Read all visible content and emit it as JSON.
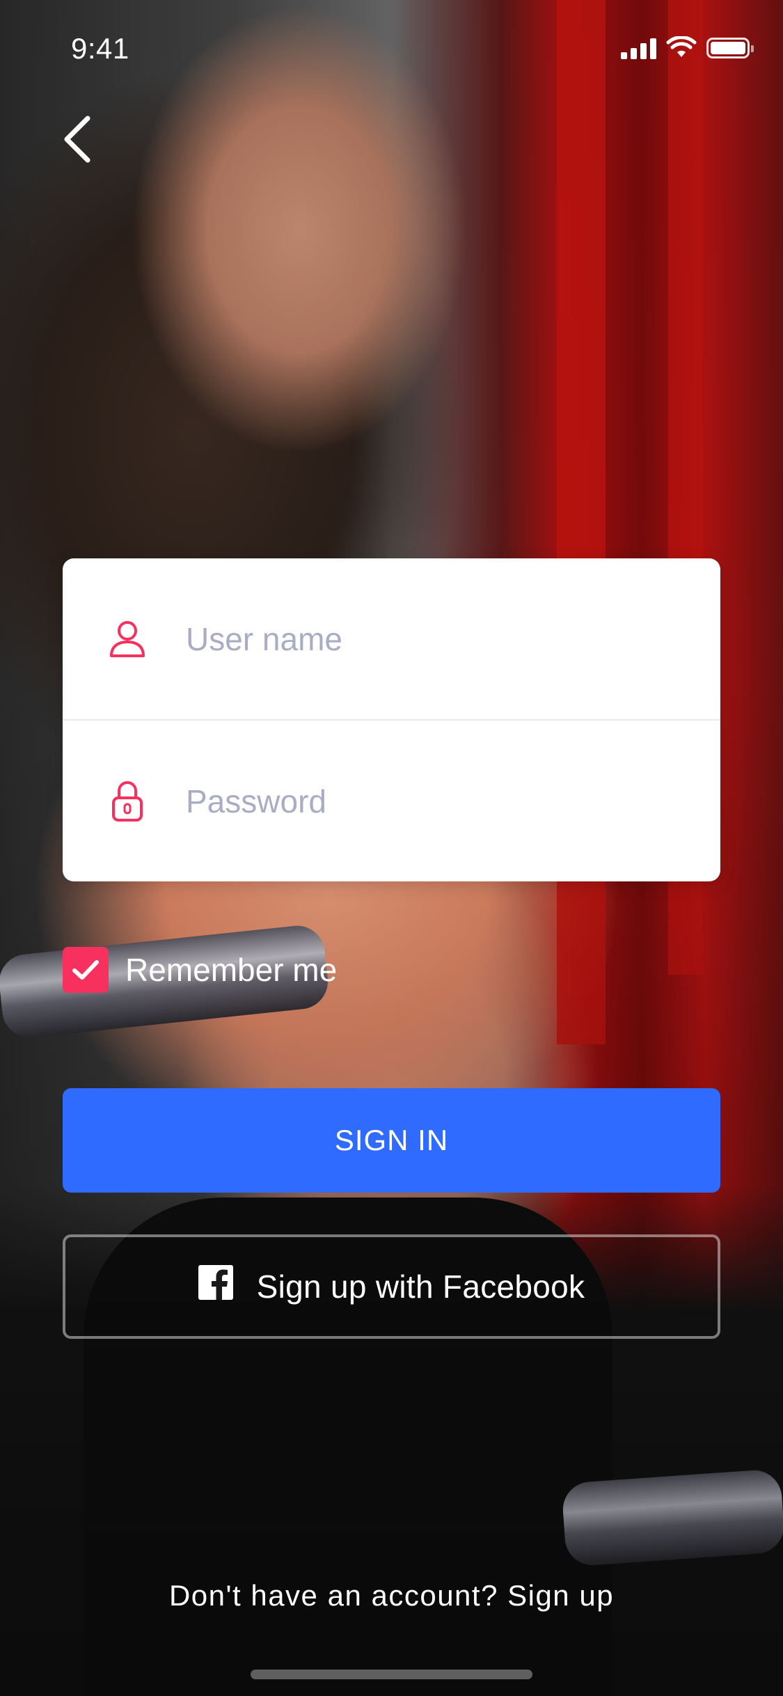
{
  "status_bar": {
    "time": "9:41",
    "icons": [
      "cellular-signal-icon",
      "wifi-icon",
      "battery-icon"
    ]
  },
  "navigation": {
    "back_icon": "chevron-left-icon"
  },
  "login_form": {
    "username": {
      "icon": "user-icon",
      "placeholder": "User name",
      "value": ""
    },
    "password": {
      "icon": "lock-icon",
      "placeholder": "Password",
      "value": ""
    }
  },
  "remember_me": {
    "label": "Remember me",
    "checked": true
  },
  "buttons": {
    "sign_in": "SIGN IN",
    "facebook": "Sign up with Facebook",
    "facebook_icon": "facebook-icon"
  },
  "footer": {
    "signup_prompt": "Don't have an account? Sign up"
  },
  "colors": {
    "accent_pink": "#f7305e",
    "primary_blue": "#2f6bff",
    "placeholder_gray": "#a9adc4"
  }
}
